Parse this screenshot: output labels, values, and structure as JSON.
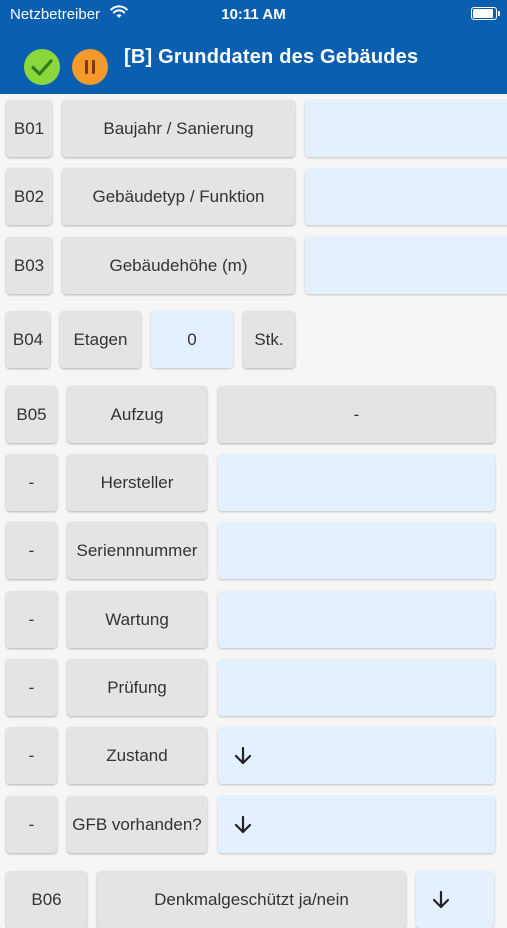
{
  "status": {
    "carrier": "Netzbetreiber",
    "time": "10:11 AM"
  },
  "header": {
    "title": "[B] Grunddaten des Gebäudes"
  },
  "rows": {
    "b01": {
      "code": "B01",
      "label": "Baujahr / Sanierung"
    },
    "b02": {
      "code": "B02",
      "label": "Gebäudetyp / Funktion"
    },
    "b03": {
      "code": "B03",
      "label": "Gebäudehöhe (m)"
    },
    "b04": {
      "code": "B04",
      "label": "Etagen",
      "value": "0",
      "unit": "Stk."
    },
    "b05": {
      "code": "B05",
      "label": "Aufzug",
      "value": "-"
    },
    "hersteller": {
      "code": "-",
      "label": "Hersteller"
    },
    "serien": {
      "code": "-",
      "label": "Seriennnummer"
    },
    "wartung": {
      "code": "-",
      "label": "Wartung"
    },
    "pruefung": {
      "code": "-",
      "label": "Prüfung"
    },
    "zustand": {
      "code": "-",
      "label": "Zustand"
    },
    "gfb": {
      "code": "-",
      "label": "GFB vorhanden?"
    },
    "b06": {
      "code": "B06",
      "label": "Denkmalgeschützt ja/nein"
    }
  }
}
